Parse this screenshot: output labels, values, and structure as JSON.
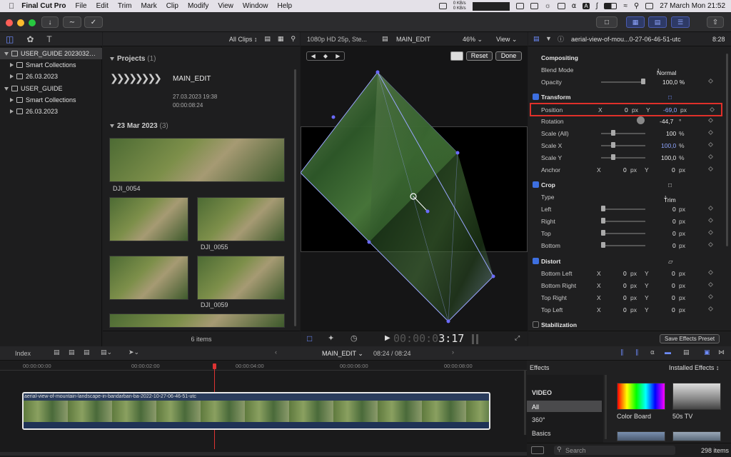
{
  "menubar": {
    "apple": "",
    "app": "Final Cut Pro",
    "items": [
      "File",
      "Edit",
      "Trim",
      "Mark",
      "Clip",
      "Modify",
      "View",
      "Window",
      "Help"
    ],
    "net_up": "0 KB/s",
    "net_down": "0 KB/s",
    "clock": "27 March Mon  21:52"
  },
  "browser": {
    "filter": "All Clips",
    "libraries": [
      {
        "label": "USER_GUIDE 2023032…",
        "level": 0,
        "expanded": true,
        "selected": true
      },
      {
        "label": "Smart Collections",
        "level": 1,
        "expanded": false
      },
      {
        "label": "26.03.2023",
        "level": 1,
        "expanded": false
      },
      {
        "label": "USER_GUIDE",
        "level": 0,
        "expanded": true
      },
      {
        "label": "Smart Collections",
        "level": 1,
        "expanded": false
      },
      {
        "label": "26.03.2023",
        "level": 1,
        "expanded": false
      }
    ],
    "projects_title": "Projects",
    "projects_count": "(1)",
    "project": {
      "name": "MAIN_EDIT",
      "date": "27.03.2023 19:38",
      "duration": "00:00:08:24"
    },
    "date_group": "23 Mar 2023",
    "date_count": "(3)",
    "clips": [
      "DJI_0054",
      "DJI_0055",
      "DJI_0059"
    ],
    "items_count": "6 items"
  },
  "viewer": {
    "format": "1080p HD 25p, Ste...",
    "project": "MAIN_EDIT",
    "zoom": "46%",
    "view": "View",
    "reset": "Reset",
    "done": "Done",
    "timecode": "00:00:0",
    "timecode_big": "3:17"
  },
  "inspector": {
    "clip_name": "aerial-view-of-mou...0-27-06-46-51-utc",
    "clip_duration": "8:28",
    "compositing": "Compositing",
    "blend_mode_label": "Blend Mode",
    "blend_mode_value": "Normal",
    "opacity_label": "Opacity",
    "opacity_value": "100,0 %",
    "transform": "Transform",
    "position_label": "Position",
    "x": "X",
    "y": "Y",
    "position_x": "0",
    "position_y": "-69,0",
    "px": "px",
    "rotation_label": "Rotation",
    "rotation_value": "-44,7",
    "deg": "°",
    "scale_all_label": "Scale (All)",
    "scale_all_value": "100",
    "scale_x_label": "Scale X",
    "scale_x_value": "100,0",
    "scale_y_label": "Scale Y",
    "scale_y_value": "100,0",
    "pct": "%",
    "anchor_label": "Anchor",
    "anchor_x": "0",
    "anchor_y": "0",
    "crop": "Crop",
    "type_label": "Type",
    "type_value": "Trim",
    "left_label": "Left",
    "right_label": "Right",
    "top_label": "Top",
    "bottom_label": "Bottom",
    "crop_value": "0",
    "distort": "Distort",
    "bl_label": "Bottom Left",
    "br_label": "Bottom Right",
    "tr_label": "Top Right",
    "tlf_label": "Top Left",
    "stabilization": "Stabilization",
    "save_preset": "Save Effects Preset"
  },
  "timeline": {
    "index": "Index",
    "project": "MAIN_EDIT",
    "duration": "08:24 / 08:24",
    "ruler": [
      "00:00:00:00",
      "00:00:02:00",
      "00:00:04:00",
      "00:00:06:00",
      "00:00:08:00"
    ],
    "clip_name": "aerial-view-of-mountain-landscape-in-bandarban-ba-2022-10-27-06-46-51-utc"
  },
  "effects": {
    "title": "Effects",
    "installed": "Installed Effects",
    "categories": [
      "VIDEO",
      "All",
      "360°",
      "Basics"
    ],
    "items": [
      "Color Board",
      "50s TV"
    ],
    "search_placeholder": "Search",
    "count": "298 items"
  },
  "colors": {
    "accent": "#3d6fe0",
    "highlight_box": "#e0302a",
    "selection": "#e5c34a"
  }
}
